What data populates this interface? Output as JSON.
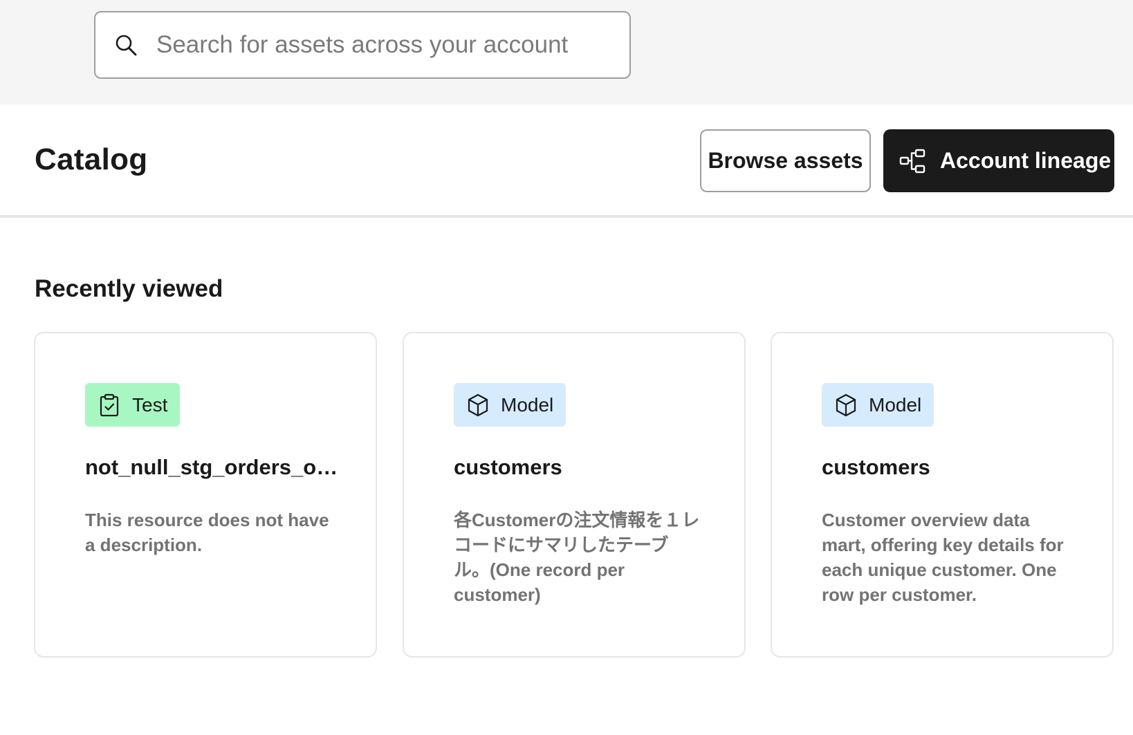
{
  "search": {
    "placeholder": "Search for assets across your account",
    "icon": "search-icon"
  },
  "header": {
    "title": "Catalog",
    "browse_label": "Browse assets",
    "lineage_label": "Account lineage",
    "lineage_icon": "lineage-icon"
  },
  "recently_viewed": {
    "title": "Recently viewed",
    "cards": [
      {
        "type": "Test",
        "icon": "clipboard-check-icon",
        "name": "not_null_stg_orders_or...",
        "description": "This resource does not have a description."
      },
      {
        "type": "Model",
        "icon": "cube-icon",
        "name": "customers",
        "description": "各Customerの注文情報を１レコードにサマリしたテーブル。(One record per customer)"
      },
      {
        "type": "Model",
        "icon": "cube-icon",
        "name": "customers",
        "description": "Customer overview data mart, offering key details for each unique customer. One row per customer."
      }
    ]
  },
  "colors": {
    "search_band_bg": "#f5f5f5",
    "primary_button_bg": "#1b1b1b",
    "test_badge_bg": "#a8f7c2",
    "model_badge_bg": "#d6ebfd",
    "description_text": "#737373"
  }
}
